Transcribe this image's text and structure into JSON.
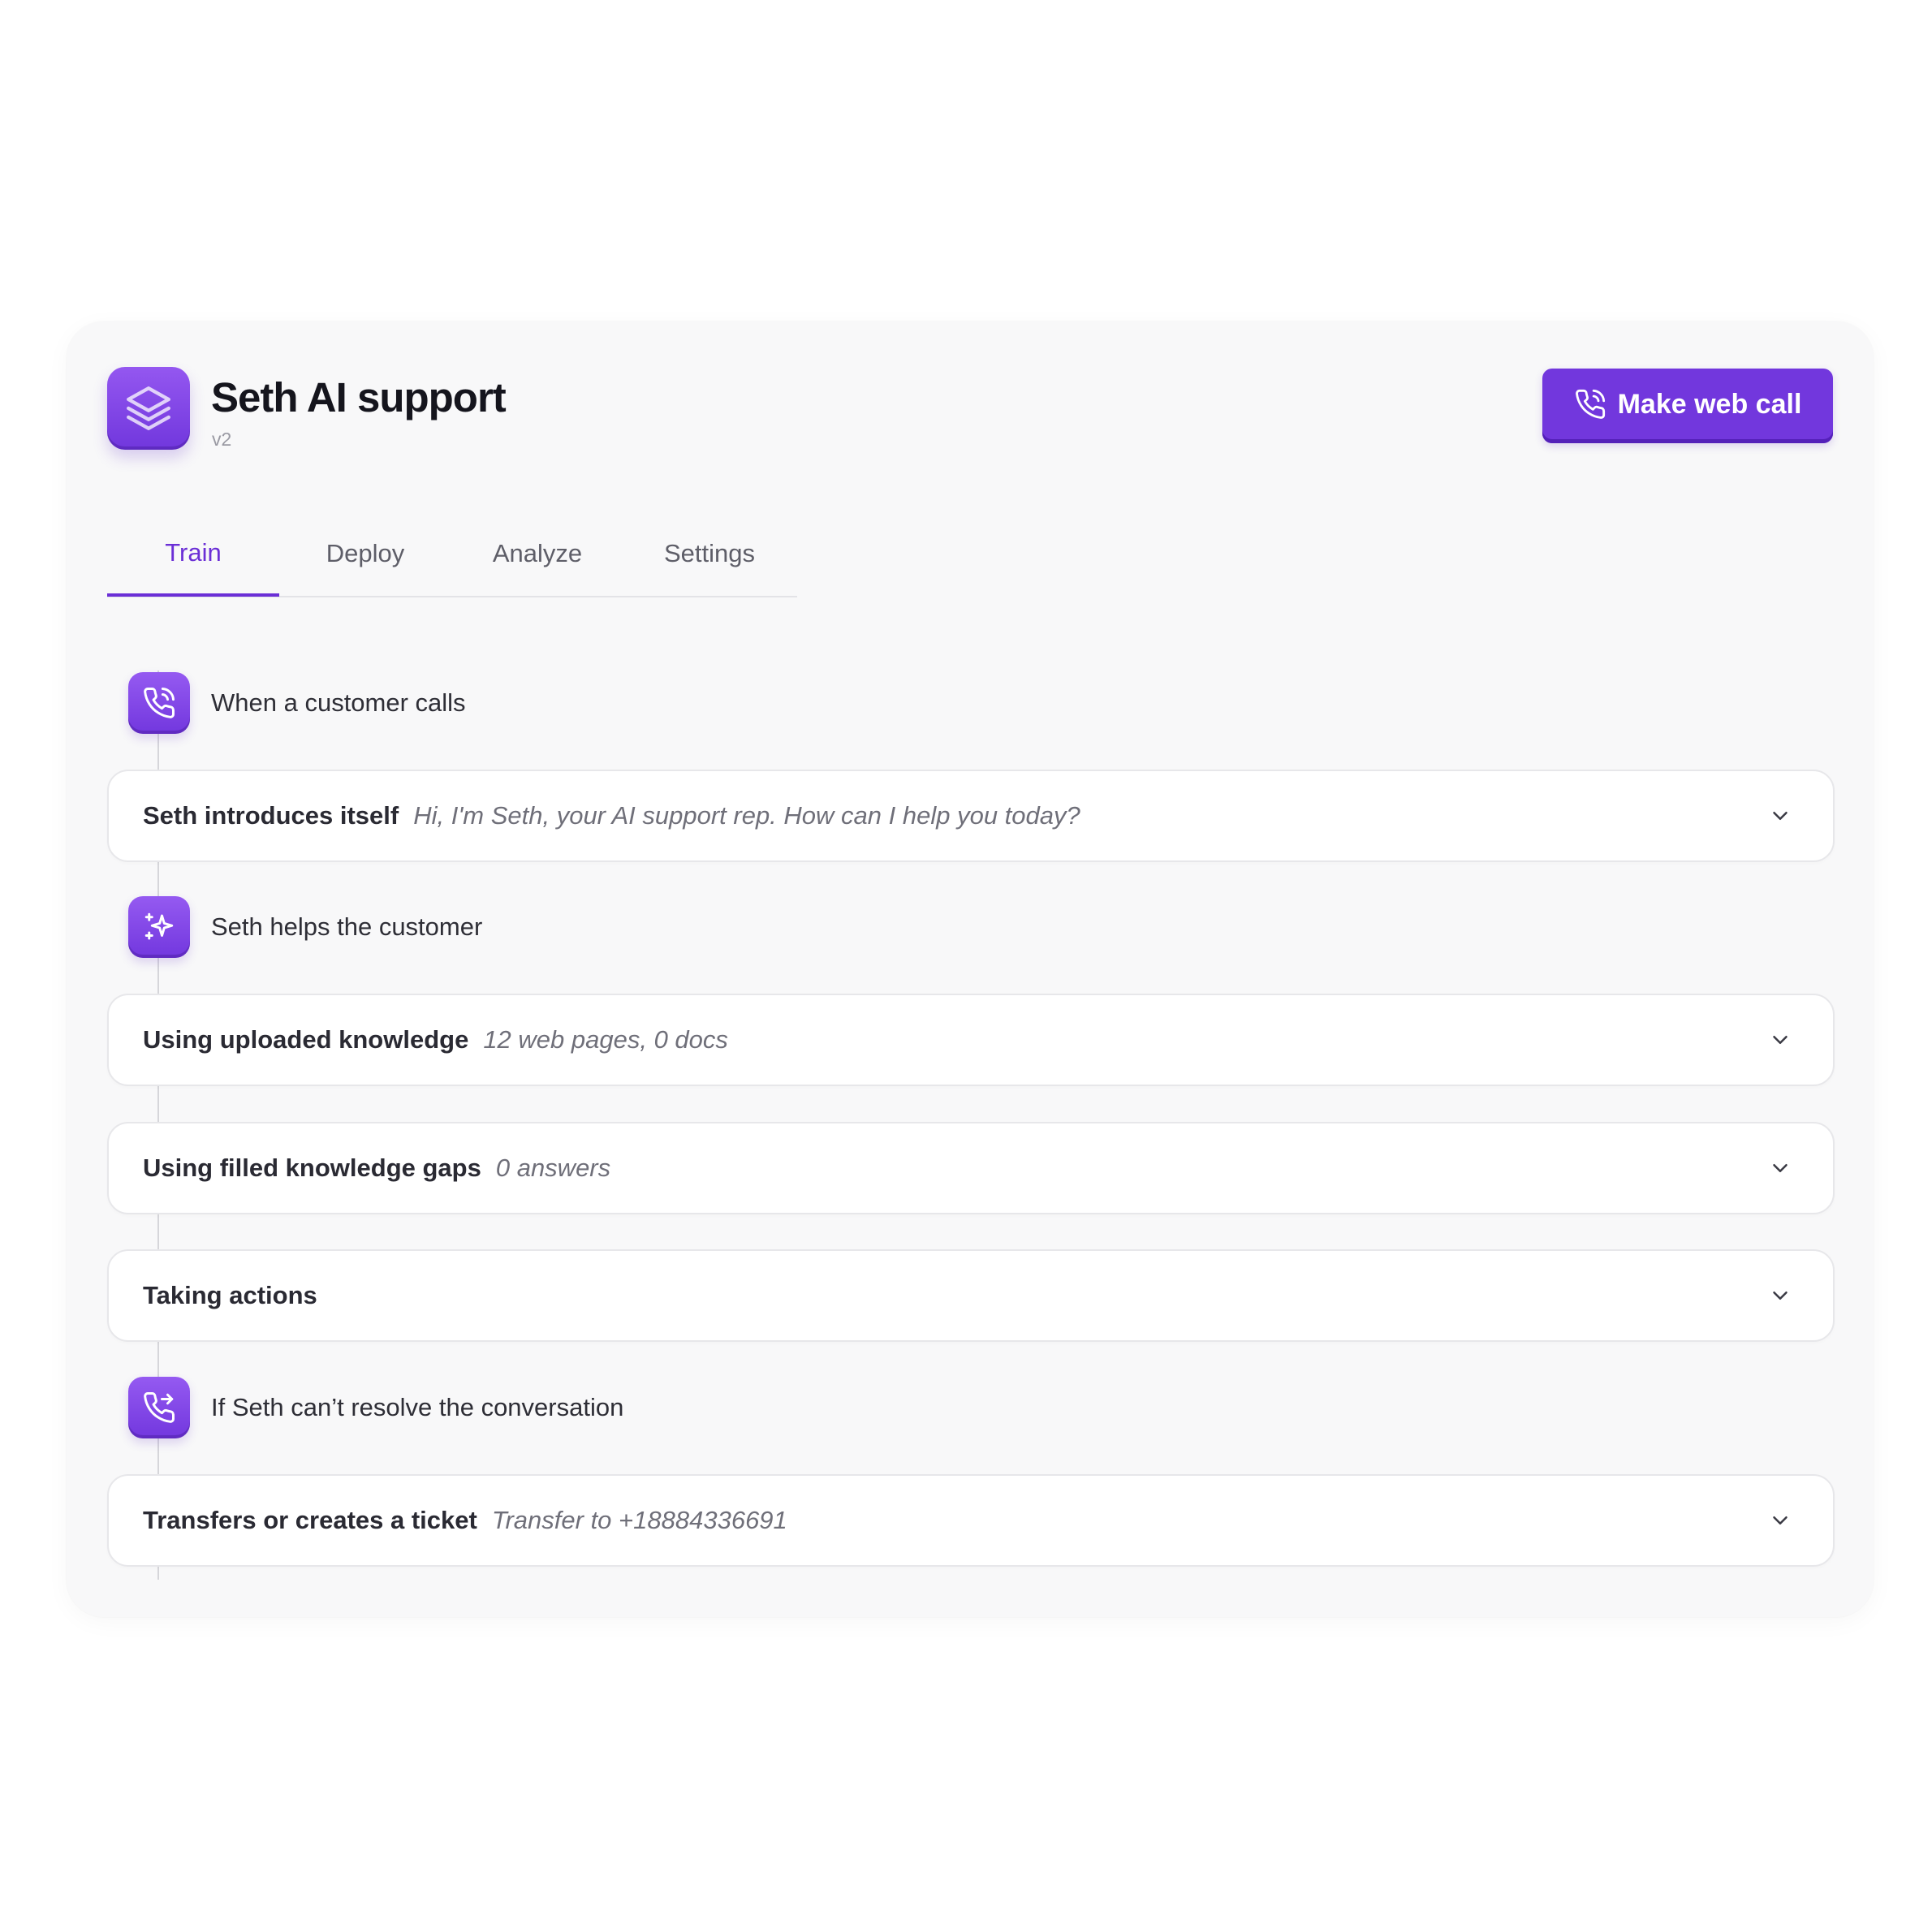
{
  "app": {
    "title": "Seth AI support",
    "version": "v2",
    "icon": "layers-icon"
  },
  "call_button": {
    "label": "Make web call",
    "icon": "phone-call-icon"
  },
  "tabs": [
    {
      "label": "Train",
      "active": true
    },
    {
      "label": "Deploy",
      "active": false
    },
    {
      "label": "Analyze",
      "active": false
    },
    {
      "label": "Settings",
      "active": false
    }
  ],
  "steps": [
    {
      "label": "When a customer calls",
      "icon": "phone-call-icon"
    },
    {
      "label": "Seth helps the customer",
      "icon": "sparkles-icon"
    },
    {
      "label": "If Seth can’t resolve the conversation",
      "icon": "phone-forward-icon"
    }
  ],
  "cards": [
    {
      "title": "Seth introduces itself",
      "subtitle": "Hi, I'm Seth, your AI support rep. How can I help you today?"
    },
    {
      "title": "Using uploaded knowledge",
      "subtitle": "12 web pages, 0 docs"
    },
    {
      "title": "Using filled knowledge gaps",
      "subtitle": "0 answers"
    },
    {
      "title": "Taking actions",
      "subtitle": ""
    },
    {
      "title": "Transfers or creates a ticket",
      "subtitle": "Transfer to +18884336691"
    }
  ],
  "colors": {
    "accent": "#7237dd",
    "tab_active": "#6b2fd6",
    "panel_bg": "#f8f8f9",
    "card_bg": "#ffffff"
  }
}
